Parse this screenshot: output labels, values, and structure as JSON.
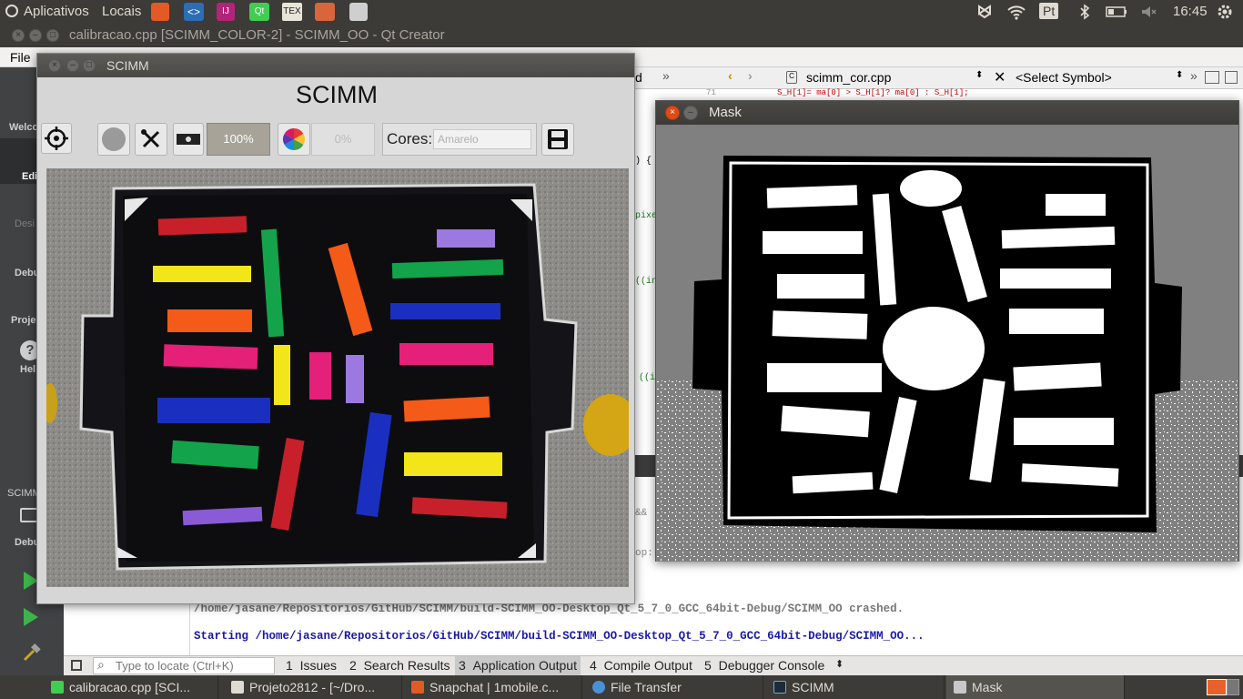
{
  "topbar": {
    "apps_label": "Aplicativos",
    "places_label": "Locais",
    "keyboard_layout": "Pt",
    "clock": "16:45"
  },
  "qtcreator": {
    "title": "calibracao.cpp [SCIMM_COLOR-2] - SCIMM_OO - Qt Creator",
    "menu_file": "File",
    "left_modes": [
      "Welco",
      "Edi",
      "Desi",
      "Debu",
      "Proje",
      "Hel"
    ],
    "run_target": "SCIMM",
    "run_debug": "Debu",
    "editor_file": "scimm_cor.cpp",
    "symbol_placeholder": "<Select Symbol>",
    "partial_tab": "d",
    "line_number": "71",
    "code_line": "S_H[1]= ma[0] > S_H[1]?  ma[0] :  S_H[1];",
    "code_fragments": [
      ") {",
      "pixe",
      "((in",
      "((i",
      "&&",
      "op:"
    ],
    "output_crashed": "/home/jasane/Repositorios/GitHub/SCIMM/build-SCIMM_OO-Desktop_Qt_5_7_0_GCC_64bit-Debug/SCIMM_OO crashed.",
    "output_starting": "Starting /home/jasane/Repositorios/GitHub/SCIMM/build-SCIMM_OO-Desktop_Qt_5_7_0_GCC_64bit-Debug/SCIMM_OO...",
    "locate_placeholder": "Type to locate (Ctrl+K)",
    "bottom_tabs": [
      {
        "num": "1",
        "label": "Issues"
      },
      {
        "num": "2",
        "label": "Search Results"
      },
      {
        "num": "3",
        "label": "Application Output"
      },
      {
        "num": "4",
        "label": "Compile Output"
      },
      {
        "num": "5",
        "label": "Debugger Console"
      }
    ]
  },
  "scimm": {
    "window_title": "SCIMM",
    "heading": "SCIMM",
    "progress_percent_1": "100%",
    "progress_percent_2": "0%",
    "cores_label": "Cores:",
    "cores_value": "Amarelo"
  },
  "mask": {
    "window_title": "Mask"
  },
  "taskbar": {
    "items": [
      {
        "label": "calibracao.cpp [SCI..."
      },
      {
        "label": "Projeto2812 - [~/Dro..."
      },
      {
        "label": "Snapchat | 1mobile.c..."
      },
      {
        "label": "File Transfer"
      },
      {
        "label": "SCIMM"
      },
      {
        "label": "Mask"
      }
    ]
  },
  "colors": {
    "panel": "#3c3b37",
    "ide_sidebar": "#404244",
    "close_orange": "#df4a16",
    "output_blue": "#1a1aa6"
  }
}
